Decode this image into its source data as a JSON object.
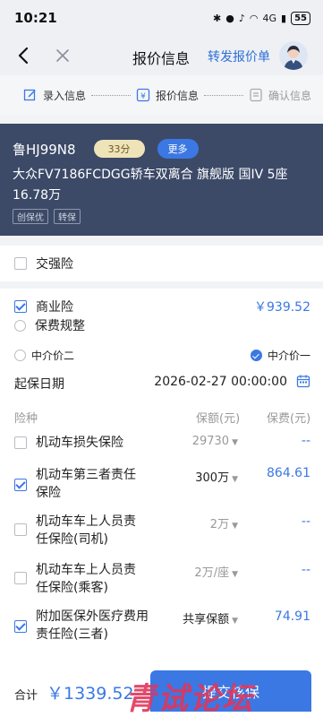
{
  "status": {
    "time": "10:21",
    "battery": "55",
    "net": "4G"
  },
  "nav": {
    "title": "报价信息",
    "forward_link": "转发报价单"
  },
  "steps": [
    {
      "label": "录入信息"
    },
    {
      "label": "报价信息"
    },
    {
      "label": "确认信息"
    }
  ],
  "car": {
    "plate": "鲁HJ99N8",
    "score": "33分",
    "more": "更多",
    "model": "大众FV7186FCDGG轿车双离合 旗舰版 国IV 5座",
    "price": "16.78万",
    "tags": [
      "创保优",
      "转保"
    ]
  },
  "compulsory": {
    "label": "交强险",
    "checked": false
  },
  "commercial": {
    "label": "商业险",
    "checked": true,
    "total": "￥939.52",
    "adjust_label": "保费规整",
    "option_left": "中介价二",
    "option_right": "中介价一",
    "start_date_label": "起保日期",
    "start_date_value": "2026-02-27 00:00:00"
  },
  "table_headers": {
    "name": "险种",
    "amount": "保额(元)",
    "fee": "保费(元)"
  },
  "insurance_items": [
    {
      "name": "机动车损失保险",
      "amount": "29730",
      "fee": "--",
      "checked": false
    },
    {
      "name": "机动车第三者责任保险",
      "amount": "300万",
      "fee": "864.61",
      "checked": true
    },
    {
      "name": "机动车车上人员责任保险(司机)",
      "amount": "2万",
      "fee": "--",
      "checked": false
    },
    {
      "name": "机动车车上人员责任保险(乘客)",
      "amount": "2万/座",
      "fee": "--",
      "checked": false
    },
    {
      "name": "附加医保外医疗费用责任险(三者)",
      "amount": "共享保额",
      "fee": "74.91",
      "checked": true
    }
  ],
  "bottom": {
    "total_label": "合计",
    "total_value": "￥1339.52",
    "submit_label": "提交核保"
  },
  "watermark": "青试论坛",
  "colors": {
    "accent": "#3b78e4",
    "card_bg": "#3c4a68"
  }
}
